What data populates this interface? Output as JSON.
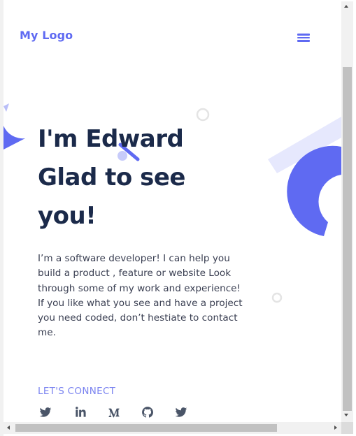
{
  "header": {
    "logo_text": "My Logo",
    "menu_icon": "hamburger-menu-icon"
  },
  "hero": {
    "title_line1": "I'm Edward",
    "title_line2": "Glad to see",
    "title_line3": "you!",
    "description": "I’m a software developer! I can help you build a product , feature or website Look through some of my work and experience! If you like what you see and have a project you need coded, don’t hestiate to contact me."
  },
  "connect": {
    "label": "LET'S CONNECT",
    "socials": [
      {
        "icon": "twitter-icon"
      },
      {
        "icon": "linkedin-icon"
      },
      {
        "icon": "medium-icon"
      },
      {
        "icon": "github-icon"
      },
      {
        "icon": "twitter-icon"
      }
    ]
  },
  "colors": {
    "accent": "#5f6af2",
    "heading": "#1b2a4a",
    "body_text": "#3a3f52",
    "connect_label": "#7b84f0",
    "icon_gray": "#4a5568",
    "deco_light": "#e6e8fd"
  }
}
